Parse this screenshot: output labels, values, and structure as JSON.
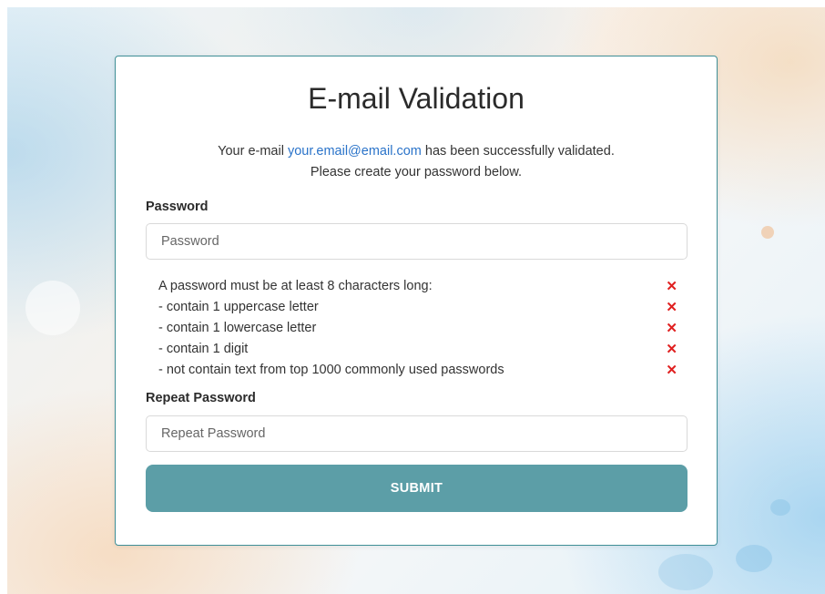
{
  "form": {
    "title": "E-mail Validation",
    "subtitle": {
      "prefix": "Your e-mail ",
      "email": "your.email@email.com",
      "suffix": " has been successfully validated.",
      "line2": "Please create your password below."
    },
    "password": {
      "label": "Password",
      "placeholder": "Password",
      "value": ""
    },
    "rules": [
      {
        "text": "A password must be at least 8 characters long:",
        "status": "✕"
      },
      {
        "text": "- contain 1 uppercase letter",
        "status": "✕"
      },
      {
        "text": "- contain 1 lowercase letter",
        "status": "✕"
      },
      {
        "text": "- contain 1 digit",
        "status": "✕"
      },
      {
        "text": "- not contain text from top 1000 commonly used passwords",
        "status": "✕"
      }
    ],
    "repeat_password": {
      "label": "Repeat Password",
      "placeholder": "Repeat Password",
      "value": ""
    },
    "submit_label": "SUBMIT"
  },
  "colors": {
    "accent": "#5c9ea7",
    "card_border": "#3f8f97",
    "link": "#2a73c9",
    "error": "#e02020"
  }
}
